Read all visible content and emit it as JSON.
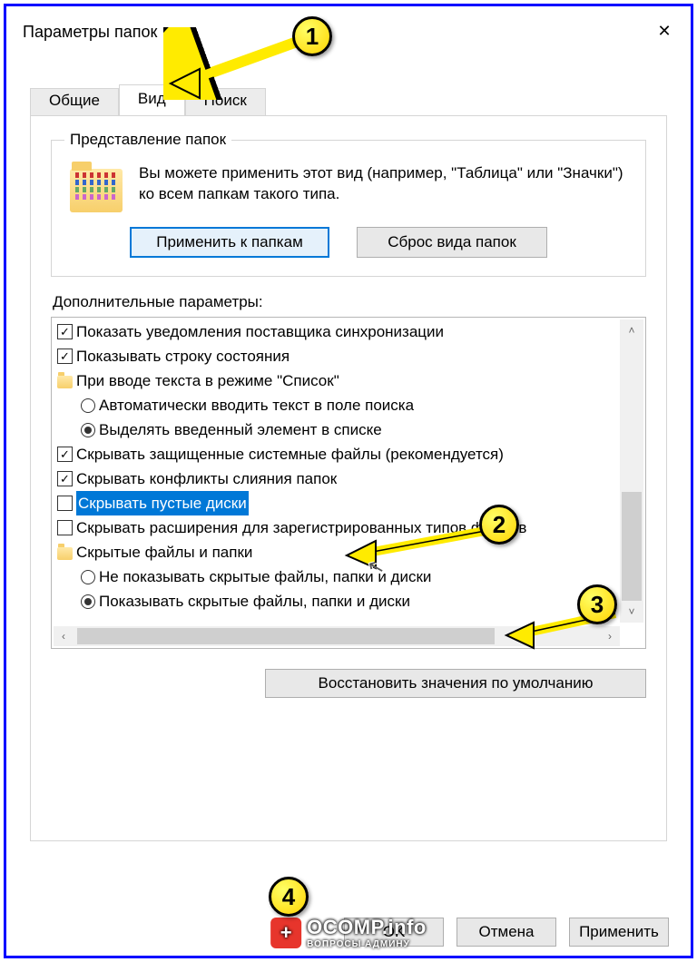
{
  "window": {
    "title": "Параметры папок"
  },
  "tabs": {
    "general": "Общие",
    "view": "Вид",
    "search": "Поиск"
  },
  "folder_views": {
    "legend": "Представление папок",
    "description": "Вы можете применить этот вид (например, \"Таблица\" или \"Значки\") ко всем папкам такого типа.",
    "apply_btn": "Применить к папкам",
    "reset_btn": "Сброс вида папок"
  },
  "advanced": {
    "label": "Дополнительные параметры:",
    "items": {
      "sync_notify": "Показать уведомления поставщика синхронизации",
      "status_bar": "Показывать строку состояния",
      "list_typing_group": "При вводе текста в режиме \"Список\"",
      "list_typing_auto": "Автоматически вводить текст в поле поиска",
      "list_typing_select": "Выделять введенный элемент в списке",
      "hide_protected": "Скрывать защищенные системные файлы (рекомендуется)",
      "hide_merge": "Скрывать конфликты слияния папок",
      "hide_empty_drives": "Скрывать пустые диски",
      "hide_ext": "Скрывать расширения для зарегистрированных типов файлов",
      "hidden_group": "Скрытые файлы и папки",
      "hidden_hide": "Не показывать скрытые файлы, папки и диски",
      "hidden_show": "Показывать скрытые файлы, папки и диски"
    },
    "restore_btn": "Восстановить значения по умолчанию"
  },
  "dialog_buttons": {
    "ok": "OK",
    "cancel": "Отмена",
    "apply": "Применить"
  },
  "annotations": {
    "b1": "1",
    "b2": "2",
    "b3": "3",
    "b4": "4"
  },
  "watermark": {
    "main": "OCOMP.info",
    "sub": "ВОПРОСЫ АДМИНУ"
  }
}
